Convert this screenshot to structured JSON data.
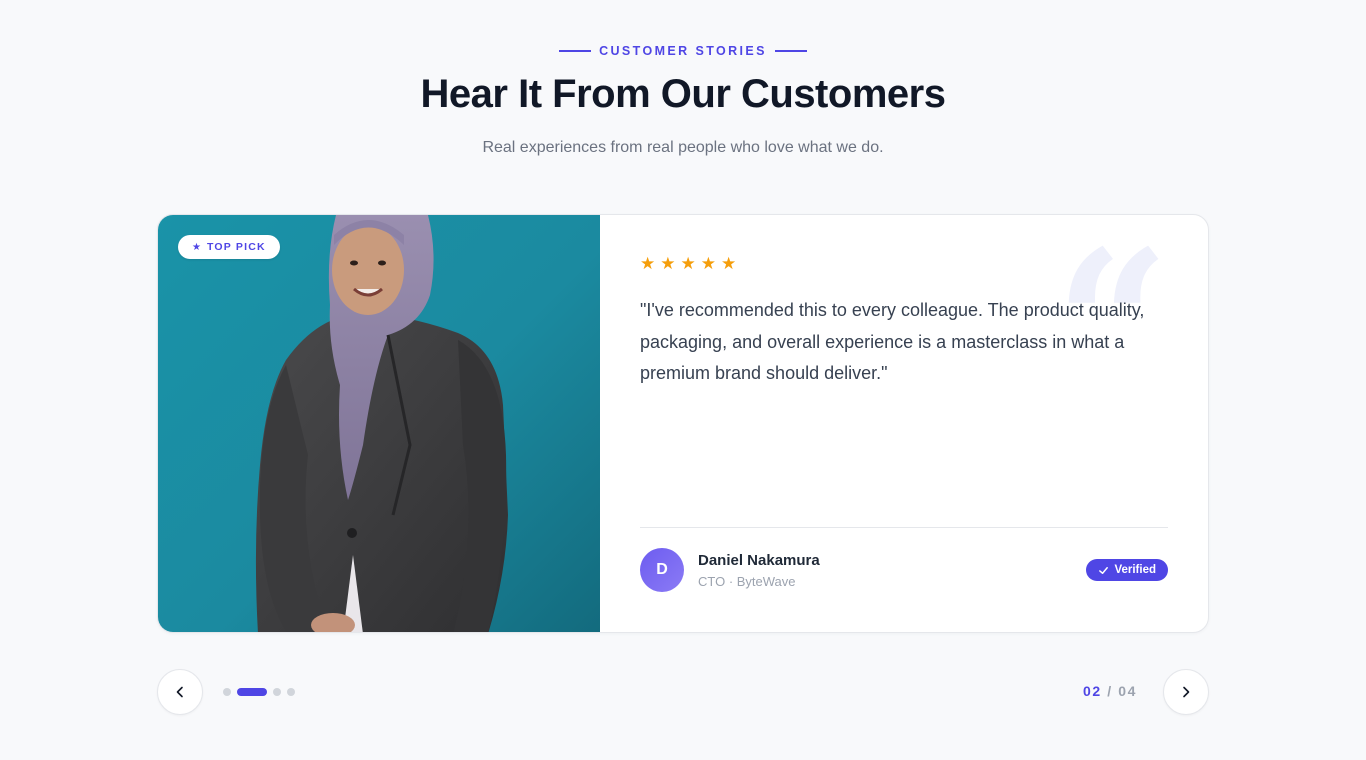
{
  "header": {
    "eyebrow": "CUSTOMER STORIES",
    "title": "Hear It From Our Customers",
    "subtitle": "Real experiences from real people who love what we do."
  },
  "testimonial": {
    "badge": "TOP PICK",
    "rating": 5,
    "quote": "\"I've recommended this to every colleague. The product quality, packaging, and overall experience is a masterclass in what a premium brand should deliver.\"",
    "author_initial": "D",
    "author_name": "Daniel Nakamura",
    "author_role": "CTO · ByteWave",
    "verified_label": "Verified"
  },
  "pager": {
    "current": "02",
    "separator": "/",
    "total": "04",
    "active_index": 1,
    "count": 4
  },
  "colors": {
    "accent": "#4f46e5",
    "star": "#f59e0b",
    "photo_bg": "#1b8aa0"
  },
  "icons": {
    "badge": "star-icon",
    "prev": "chevron-left-icon",
    "next": "chevron-right-icon",
    "verified": "check-icon",
    "quote": "quote-mark-icon"
  }
}
